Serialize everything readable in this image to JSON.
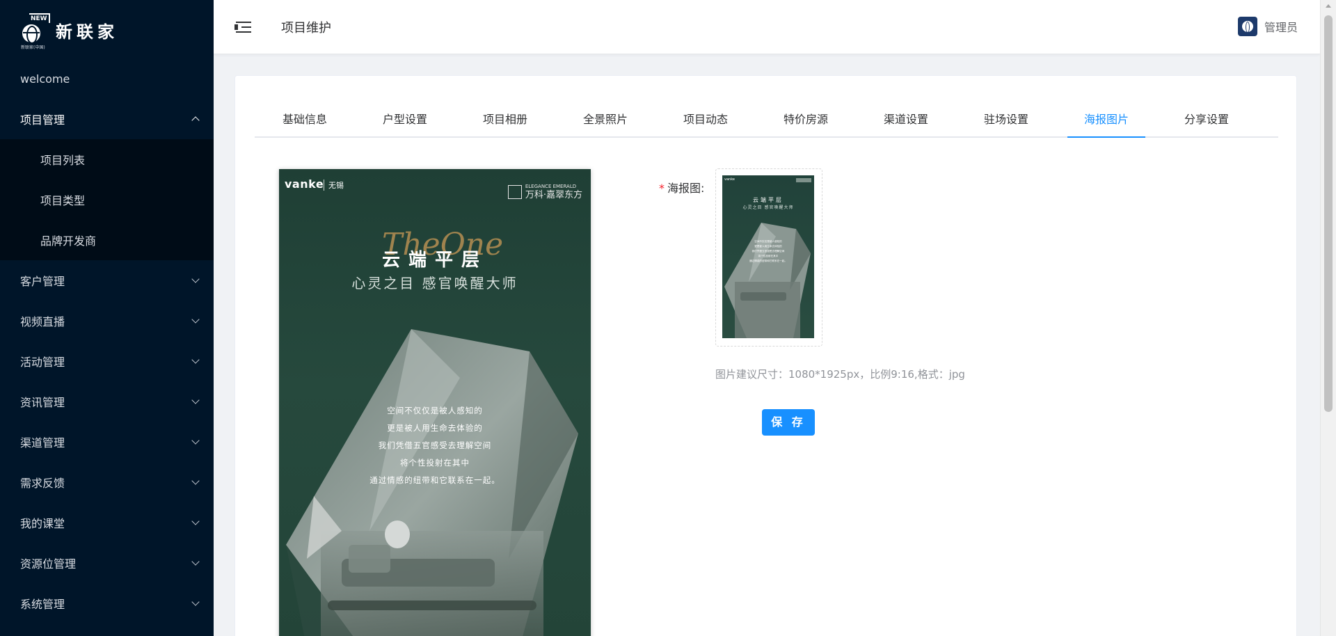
{
  "app": {
    "logo_badge": "NEW",
    "logo_subtext": "新联家(中国)",
    "logo_text": "新联家"
  },
  "sidebar": {
    "items": [
      {
        "label": "welcome",
        "expandable": false
      },
      {
        "label": "项目管理",
        "expandable": true,
        "open": true,
        "children": [
          {
            "label": "项目列表"
          },
          {
            "label": "项目类型"
          },
          {
            "label": "品牌开发商"
          }
        ]
      },
      {
        "label": "客户管理",
        "expandable": true
      },
      {
        "label": "视频直播",
        "expandable": true
      },
      {
        "label": "活动管理",
        "expandable": true
      },
      {
        "label": "资讯管理",
        "expandable": true
      },
      {
        "label": "渠道管理",
        "expandable": true
      },
      {
        "label": "需求反馈",
        "expandable": true
      },
      {
        "label": "我的课堂",
        "expandable": true
      },
      {
        "label": "资源位管理",
        "expandable": true
      },
      {
        "label": "系统管理",
        "expandable": true
      }
    ]
  },
  "header": {
    "title": "项目维护",
    "user": "管理员"
  },
  "tabs": {
    "items": [
      "基础信息",
      "户型设置",
      "项目相册",
      "全景照片",
      "项目动态",
      "特价房源",
      "渠道设置",
      "驻场设置",
      "海报图片",
      "分享设置"
    ],
    "active_index": 8
  },
  "poster": {
    "brand": "vanke",
    "brand_city": "无锡",
    "emblem_en": "ELEGANCE EMERALD",
    "emblem_cn": "万科·嘉翠东方",
    "script": "TheOne",
    "headline": "云端平层",
    "tagline": "心灵之目 感官唤醒大师",
    "body": [
      "空间不仅仅是被人感知的",
      "更是被人用生命去体验的",
      "我们凭借五官感受去理解空间",
      "将个性投射在其中",
      "通过情感的纽带和它联系在一起。"
    ]
  },
  "form": {
    "label": "海报图:",
    "required_mark": "*",
    "hint": "图片建议尺寸：1080*1925px，比例9:16,格式：jpg",
    "save_label": "保 存"
  },
  "colors": {
    "sidebar_bg": "#001529",
    "submenu_bg": "#000c17",
    "accent": "#1890ff",
    "required": "#f5222d",
    "poster_green": "#234438"
  },
  "icons": {
    "collapse": "menu-fold-icon",
    "chevron": "chevron-down-icon",
    "chevron_open": "chevron-up-icon"
  }
}
